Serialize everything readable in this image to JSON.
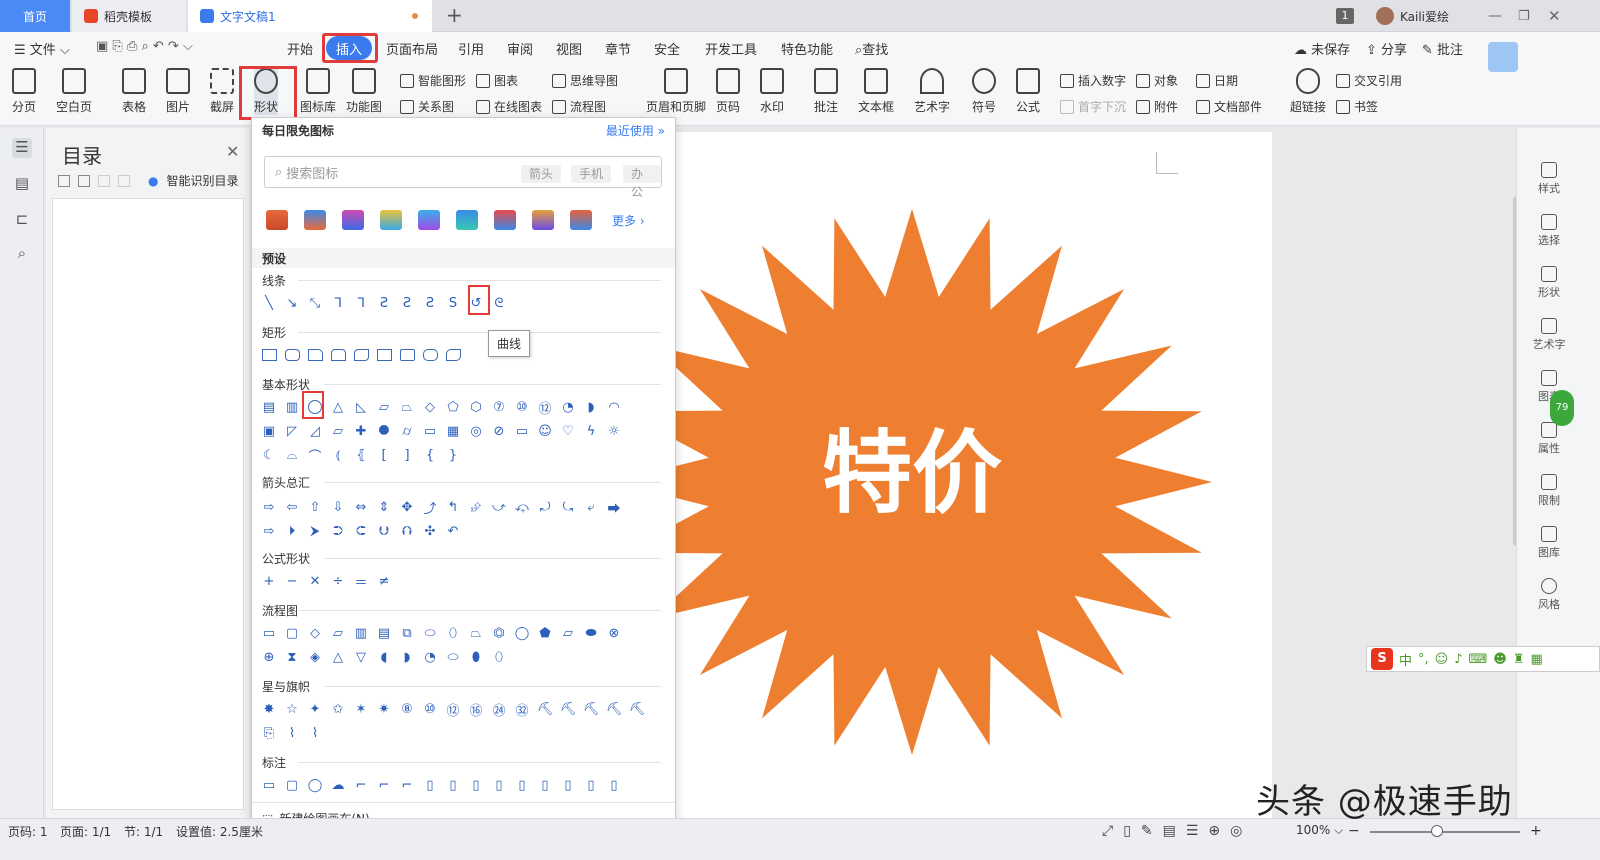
{
  "tabs": {
    "home": "首页",
    "template": "稻壳模板",
    "document": "文字文稿1",
    "new_tab": "+"
  },
  "window": {
    "badge_count": "1",
    "user": "Kaili爱绘"
  },
  "menu": {
    "file": "文件",
    "items": [
      "开始",
      "插入",
      "页面布局",
      "引用",
      "审阅",
      "视图",
      "章节",
      "安全",
      "开发工具",
      "特色功能"
    ],
    "search": "查找",
    "unsaved": "未保存",
    "share": "分享",
    "comment": "批注"
  },
  "ribbon": {
    "page_break": "分页",
    "blank_page": "空白页",
    "table": "表格",
    "picture": "图片",
    "screenshot": "截屏",
    "shape": "形状",
    "icon_lib": "图标库",
    "func_chart": "功能图",
    "smart_graphic": "智能图形",
    "chart": "图表",
    "mind_map": "思维导图",
    "relation": "关系图",
    "online_chart": "在线图表",
    "flowchart": "流程图",
    "header_footer": "页眉和页脚",
    "page_number": "页码",
    "watermark": "水印",
    "annotation": "批注",
    "textbox": "文本框",
    "wordart": "艺术字",
    "symbol": "符号",
    "formula": "公式",
    "insert_number": "插入数字",
    "object": "对象",
    "date": "日期",
    "drop_cap": "首字下沉",
    "attachment": "附件",
    "doc_parts": "文档部件",
    "hyperlink": "超链接",
    "cross_ref": "交叉引用",
    "bookmark": "书签"
  },
  "toc": {
    "title": "目录",
    "smart": "智能识别目录"
  },
  "panel": {
    "daily_free": "每日限免图标",
    "recent": "最近使用",
    "search_placeholder": "搜索图标",
    "chips": [
      "箭头",
      "手机",
      "办公"
    ],
    "more": "更多",
    "preset": "预设",
    "sections": {
      "lines": "线条",
      "rect": "矩形",
      "basic": "基本形状",
      "arrows": "箭头总汇",
      "formula": "公式形状",
      "flow": "流程图",
      "stars": "星与旗帜",
      "callouts": "标注"
    },
    "tooltip": "曲线",
    "new_canvas": "新建绘图画布(N)"
  },
  "document": {
    "burst_text": "特价",
    "burst_color": "#ee7f31"
  },
  "rightrail": [
    "样式",
    "选择",
    "形状",
    "艺术字",
    "图表",
    "属性",
    "限制",
    "图库",
    "风格"
  ],
  "ime": {
    "label": "中"
  },
  "status": {
    "page_code": "页码: 1",
    "pages": "页面: 1/1",
    "section": "节: 1/1",
    "setting": "设置值: 2.5厘米",
    "zoom": "100%"
  },
  "watermark": "头条 @极速手助",
  "green_badge": "79"
}
